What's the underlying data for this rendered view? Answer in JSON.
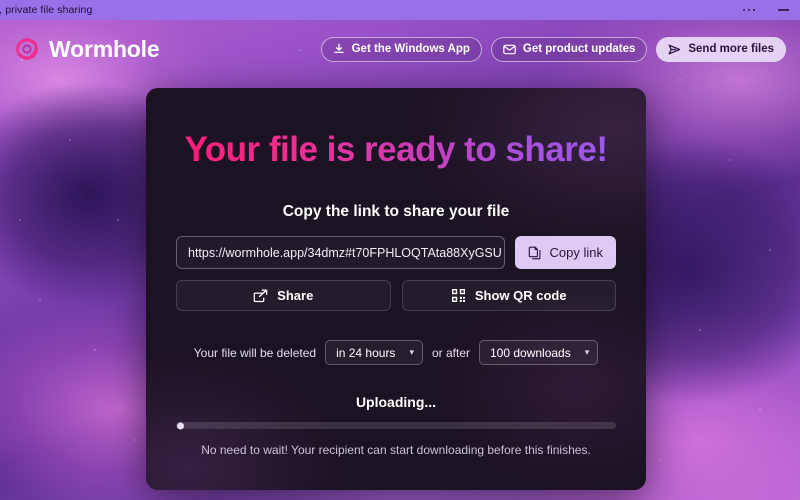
{
  "window": {
    "title": "mple, private file sharing",
    "menu_icon": "more-dots-icon",
    "minimize_icon": "minimize-icon"
  },
  "header": {
    "logo_icon": "wormhole-spiral-logo",
    "brand": "Wormhole",
    "actions": [
      {
        "label": "Get the Windows App",
        "icon": "download-icon",
        "style": "ghost"
      },
      {
        "label": "Get product updates",
        "icon": "envelope-icon",
        "style": "ghost"
      },
      {
        "label": "Send more files",
        "icon": "paper-plane-icon",
        "style": "solid"
      }
    ]
  },
  "card": {
    "hero_title": "Your file is ready to share!",
    "copy_section_label": "Copy the link to share your file",
    "url": "https://wormhole.app/34dmz#t70FPHLOQTAta88XyGSU",
    "copy_button": {
      "label": "Copy link",
      "icon": "copy-icon"
    },
    "share_button": {
      "label": "Share",
      "icon": "share-icon"
    },
    "qr_button": {
      "label": "Show QR code",
      "icon": "qr-code-icon"
    },
    "expiry": {
      "prefix": "Your file will be deleted",
      "time_value": "in 24 hours",
      "conjunction": "or after",
      "downloads_value": "100 downloads",
      "chevron": "▾"
    },
    "upload": {
      "status": "Uploading...",
      "progress_percent": 1,
      "note": "No need to wait! Your recipient can start downloading before this finishes."
    }
  },
  "colors": {
    "titlebar": "#9a70e8",
    "card_bg": "#1b1222",
    "accent_pink": "#ff1a7a",
    "accent_purple": "#9a5ae8",
    "button_light": "#ddc9f2"
  }
}
